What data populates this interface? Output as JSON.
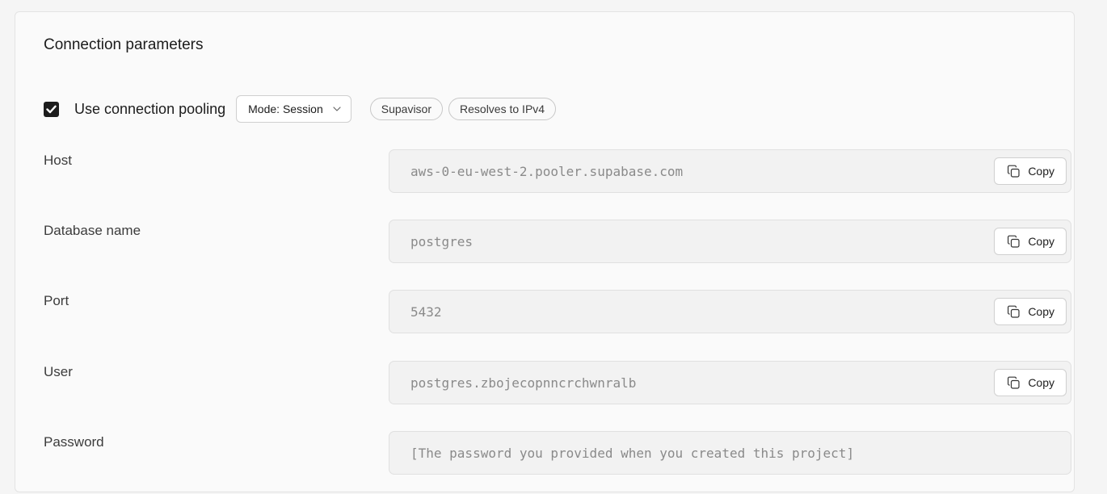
{
  "title": "Connection parameters",
  "pooling": {
    "checked": true,
    "label": "Use connection pooling",
    "mode_label": "Mode: Session",
    "badges": [
      "Supavisor",
      "Resolves to IPv4"
    ]
  },
  "copy_label": "Copy",
  "fields": [
    {
      "label": "Host",
      "value": "aws-0-eu-west-2.pooler.supabase.com",
      "copyable": true
    },
    {
      "label": "Database name",
      "value": "postgres",
      "copyable": true
    },
    {
      "label": "Port",
      "value": "5432",
      "copyable": true
    },
    {
      "label": "User",
      "value": "postgres.zbojecopnncrchwnralb",
      "copyable": true
    },
    {
      "label": "Password",
      "value": "[The password you provided when you created this project]",
      "copyable": false
    }
  ]
}
